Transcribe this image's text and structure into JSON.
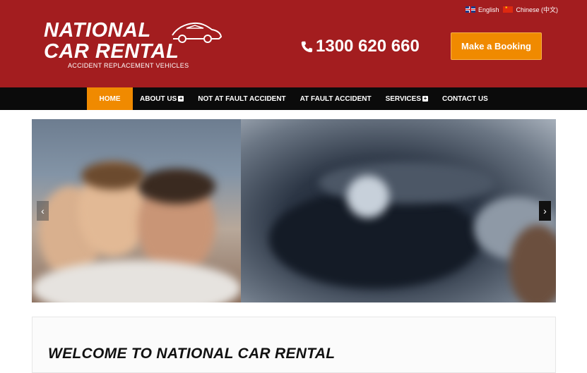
{
  "lang": {
    "english": "English",
    "chinese": "Chinese (中文)"
  },
  "logo": {
    "line1": "NATIONAL",
    "line2": "CAR RENTAL",
    "tagline": "ACCIDENT REPLACEMENT VEHICLES"
  },
  "header": {
    "phone": "1300 620 660",
    "booking_label": "Make a Booking",
    "background": "#a31d1f",
    "accent": "#f08a00"
  },
  "nav": {
    "items": [
      {
        "label": "HOME",
        "active": true
      },
      {
        "label": "ABOUT US",
        "has_submenu": true
      },
      {
        "label": "NOT AT FAULT ACCIDENT"
      },
      {
        "label": "AT FAULT ACCIDENT"
      },
      {
        "label": "SERVICES",
        "has_submenu": true
      },
      {
        "label": "CONTACT US"
      }
    ]
  },
  "slider": {
    "prev_icon": "‹",
    "next_icon": "›"
  },
  "welcome": {
    "title": "WELCOME TO NATIONAL CAR RENTAL"
  }
}
